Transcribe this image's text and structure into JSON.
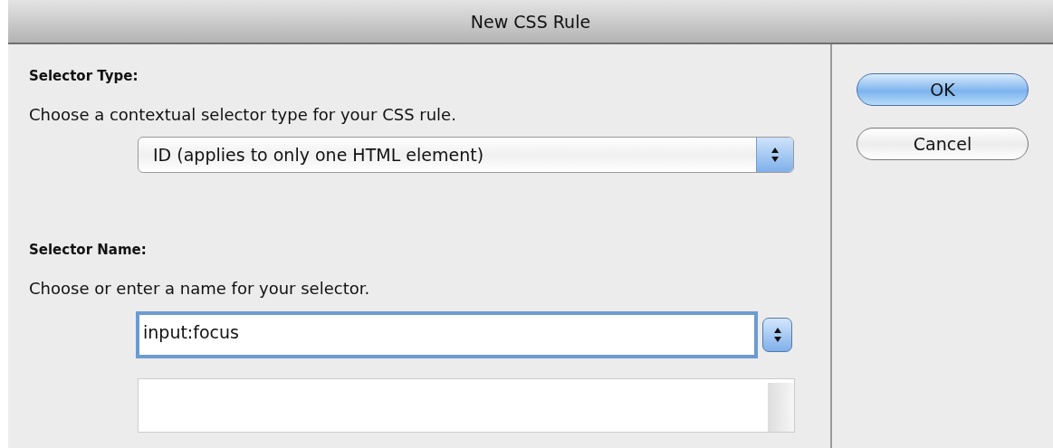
{
  "window": {
    "title": "New CSS Rule"
  },
  "selector_type": {
    "label": "Selector Type:",
    "description": "Choose a contextual selector type for your CSS rule.",
    "dropdown": {
      "value": "ID (applies to only one HTML element)"
    }
  },
  "selector_name": {
    "label": "Selector Name:",
    "description": "Choose or enter a name for your selector.",
    "field": {
      "value": "input:focus",
      "focused": true
    }
  },
  "buttons": [
    {
      "label": "OK",
      "default": true
    },
    {
      "label": "Cancel",
      "default": false
    }
  ]
}
